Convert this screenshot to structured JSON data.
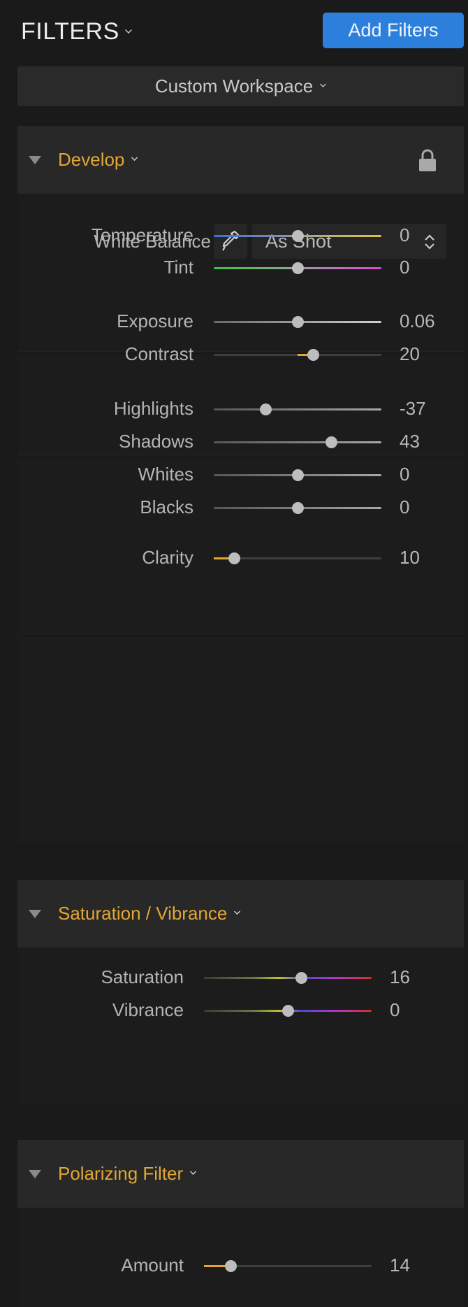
{
  "header": {
    "title": "FILTERS",
    "add_filters_label": "Add Filters",
    "workspace_label": "Custom Workspace"
  },
  "colors": {
    "accent_orange": "#e3a634",
    "button_blue": "#2d7fdc",
    "panel_bg": "#1c1c1c",
    "header_bg": "#282828"
  },
  "develop": {
    "title": "Develop",
    "locked": true,
    "white_balance": {
      "label": "White Balance",
      "selected": "As Shot"
    },
    "sliders": [
      {
        "key": "temperature",
        "label": "Temperature",
        "value": "0",
        "position": 0.5,
        "style": "temperature"
      },
      {
        "key": "tint",
        "label": "Tint",
        "value": "0",
        "position": 0.5,
        "style": "tint"
      },
      {
        "key": "exposure",
        "label": "Exposure",
        "value": "0.06",
        "position": 0.5,
        "style": "light"
      },
      {
        "key": "contrast",
        "label": "Contrast",
        "value": "20",
        "position": 0.59,
        "style": "plain",
        "fill_from": 0.5
      },
      {
        "key": "highlights",
        "label": "Highlights",
        "value": "-37",
        "position": 0.31,
        "style": "gradient"
      },
      {
        "key": "shadows",
        "label": "Shadows",
        "value": "43",
        "position": 0.7,
        "style": "gradient"
      },
      {
        "key": "whites",
        "label": "Whites",
        "value": "0",
        "position": 0.5,
        "style": "gradient"
      },
      {
        "key": "blacks",
        "label": "Blacks",
        "value": "0",
        "position": 0.5,
        "style": "gradient"
      },
      {
        "key": "clarity",
        "label": "Clarity",
        "value": "10",
        "position": 0.12,
        "style": "plain",
        "fill_from": 0
      }
    ]
  },
  "saturation_vibrance": {
    "title": "Saturation / Vibrance",
    "sliders": [
      {
        "key": "saturation",
        "label": "Saturation",
        "value": "16",
        "position": 0.58,
        "style": "rainbow"
      },
      {
        "key": "vibrance",
        "label": "Vibrance",
        "value": "0",
        "position": 0.5,
        "style": "rainbow"
      }
    ]
  },
  "polarizing_filter": {
    "title": "Polarizing Filter",
    "sliders": [
      {
        "key": "amount",
        "label": "Amount",
        "value": "14",
        "position": 0.16,
        "style": "plain",
        "fill_from": 0
      }
    ]
  }
}
